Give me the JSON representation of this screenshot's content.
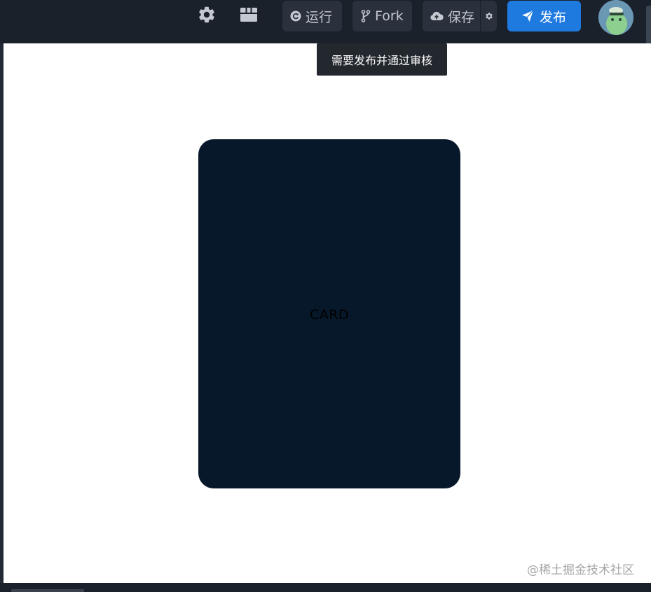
{
  "toolbar": {
    "settings_icon": "gear-icon",
    "layout_icon": "layout-grid-icon",
    "run_label": "运行",
    "fork_label": "Fork",
    "save_label": "保存",
    "publish_label": "发布"
  },
  "tooltip": {
    "text": "需要发布并通过审核"
  },
  "preview": {
    "card_label": "CARD"
  },
  "watermark": {
    "text": "@稀土掘金技术社区"
  },
  "colors": {
    "topbar_bg": "#1b212b",
    "button_bg": "#2a313c",
    "publish_bg": "#1f7ae0",
    "card_bg": "#08182b",
    "preview_bg": "#ffffff",
    "tooltip_bg": "#23272e"
  }
}
